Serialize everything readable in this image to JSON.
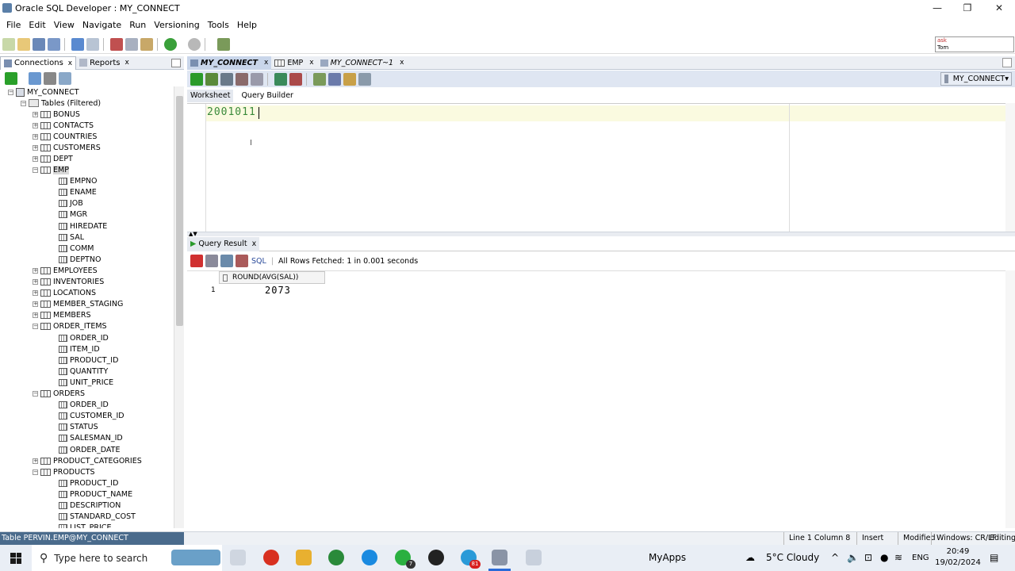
{
  "window": {
    "title": "Oracle SQL Developer : MY_CONNECT",
    "minimize": "—",
    "maximize": "❐",
    "close": "✕"
  },
  "menu": [
    "File",
    "Edit",
    "View",
    "Navigate",
    "Run",
    "Versioning",
    "Tools",
    "Help"
  ],
  "ask": {
    "text1": "ask",
    "text2": "Tom"
  },
  "left_tabs": {
    "connections": "Connections",
    "reports": "Reports",
    "close": "x"
  },
  "tree": {
    "root": "MY_CONNECT",
    "tables_folder": "Tables (Filtered)",
    "nodes": [
      {
        "label": "BONUS"
      },
      {
        "label": "CONTACTS"
      },
      {
        "label": "COUNTRIES"
      },
      {
        "label": "CUSTOMERS"
      },
      {
        "label": "DEPT"
      },
      {
        "label": "EMP"
      },
      {
        "label": "EMPNO"
      },
      {
        "label": "ENAME"
      },
      {
        "label": "JOB"
      },
      {
        "label": "MGR"
      },
      {
        "label": "HIREDATE"
      },
      {
        "label": "SAL"
      },
      {
        "label": "COMM"
      },
      {
        "label": "DEPTNO"
      },
      {
        "label": "EMPLOYEES"
      },
      {
        "label": "INVENTORIES"
      },
      {
        "label": "LOCATIONS"
      },
      {
        "label": "MEMBER_STAGING"
      },
      {
        "label": "MEMBERS"
      },
      {
        "label": "ORDER_ITEMS"
      },
      {
        "label": "ORDER_ID"
      },
      {
        "label": "ITEM_ID"
      },
      {
        "label": "PRODUCT_ID"
      },
      {
        "label": "QUANTITY"
      },
      {
        "label": "UNIT_PRICE"
      },
      {
        "label": "ORDERS"
      },
      {
        "label": "ORDER_ID"
      },
      {
        "label": "CUSTOMER_ID"
      },
      {
        "label": "STATUS"
      },
      {
        "label": "SALESMAN_ID"
      },
      {
        "label": "ORDER_DATE"
      },
      {
        "label": "PRODUCT_CATEGORIES"
      },
      {
        "label": "PRODUCTS"
      },
      {
        "label": "PRODUCT_ID"
      },
      {
        "label": "PRODUCT_NAME"
      },
      {
        "label": "DESCRIPTION"
      },
      {
        "label": "STANDARD_COST"
      },
      {
        "label": "LIST_PRICE"
      }
    ]
  },
  "editor_tabs": [
    {
      "label": "MY_CONNECT",
      "close": "x"
    },
    {
      "label": "EMP",
      "close": "x"
    },
    {
      "label": "MY_CONNECT~1",
      "close": "x"
    }
  ],
  "connection_select": "MY_CONNECT",
  "sub_tabs": {
    "worksheet": "Worksheet",
    "query_builder": "Query Builder"
  },
  "editor": {
    "text": "2001011",
    "ibeam": "I"
  },
  "result": {
    "tab": "Query Result",
    "close": "x",
    "sql_label": "SQL",
    "status": "All Rows Fetched: 1 in 0.001 seconds",
    "column": "ROUND(AVG(SAL))",
    "row_number": "1",
    "value": "2073"
  },
  "statusbar": {
    "left": "Table PERVIN.EMP@MY_CONNECT",
    "position": "Line 1 Column 8",
    "mode": "Insert",
    "modified": "Modified",
    "eol": "Windows: CR/LF",
    "editing": "Editing"
  },
  "taskbar": {
    "search": "Type here to search",
    "myapps": "MyApps",
    "weather": "5°C  Cloudy",
    "lang": "ENG",
    "time": "20:49",
    "date": "19/02/2024",
    "badge_whatsapp": "7",
    "badge_telegram": "81"
  },
  "colors": {
    "accent": "#4a6b8c",
    "sql_text": "#3a8a3a",
    "tab_active": "#c9d6ea"
  }
}
